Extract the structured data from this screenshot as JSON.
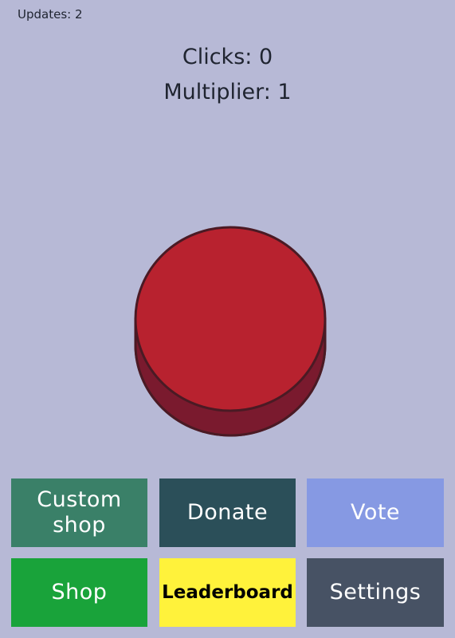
{
  "status": {
    "updates": "Updates: 2"
  },
  "stats": {
    "clicks": "Clicks: 0",
    "multiplier": "Multiplier: 1"
  },
  "main_button": {
    "icon": "red-click-button",
    "top_color": "#b8222f",
    "side_color": "#7a1a2e"
  },
  "buttons": [
    {
      "label": "Custom\nshop",
      "bg": "#3a8068",
      "fg": "#ffffff"
    },
    {
      "label": "Donate",
      "bg": "#2b4f59",
      "fg": "#ffffff"
    },
    {
      "label": "Vote",
      "bg": "#8699e3",
      "fg": "#ffffff"
    },
    {
      "label": "Shop",
      "bg": "#19a33a",
      "fg": "#ffffff"
    },
    {
      "label": "Leaderboard",
      "bg": "#fff23b",
      "fg": "#000000"
    },
    {
      "label": "Settings",
      "bg": "#475264",
      "fg": "#ffffff"
    }
  ]
}
